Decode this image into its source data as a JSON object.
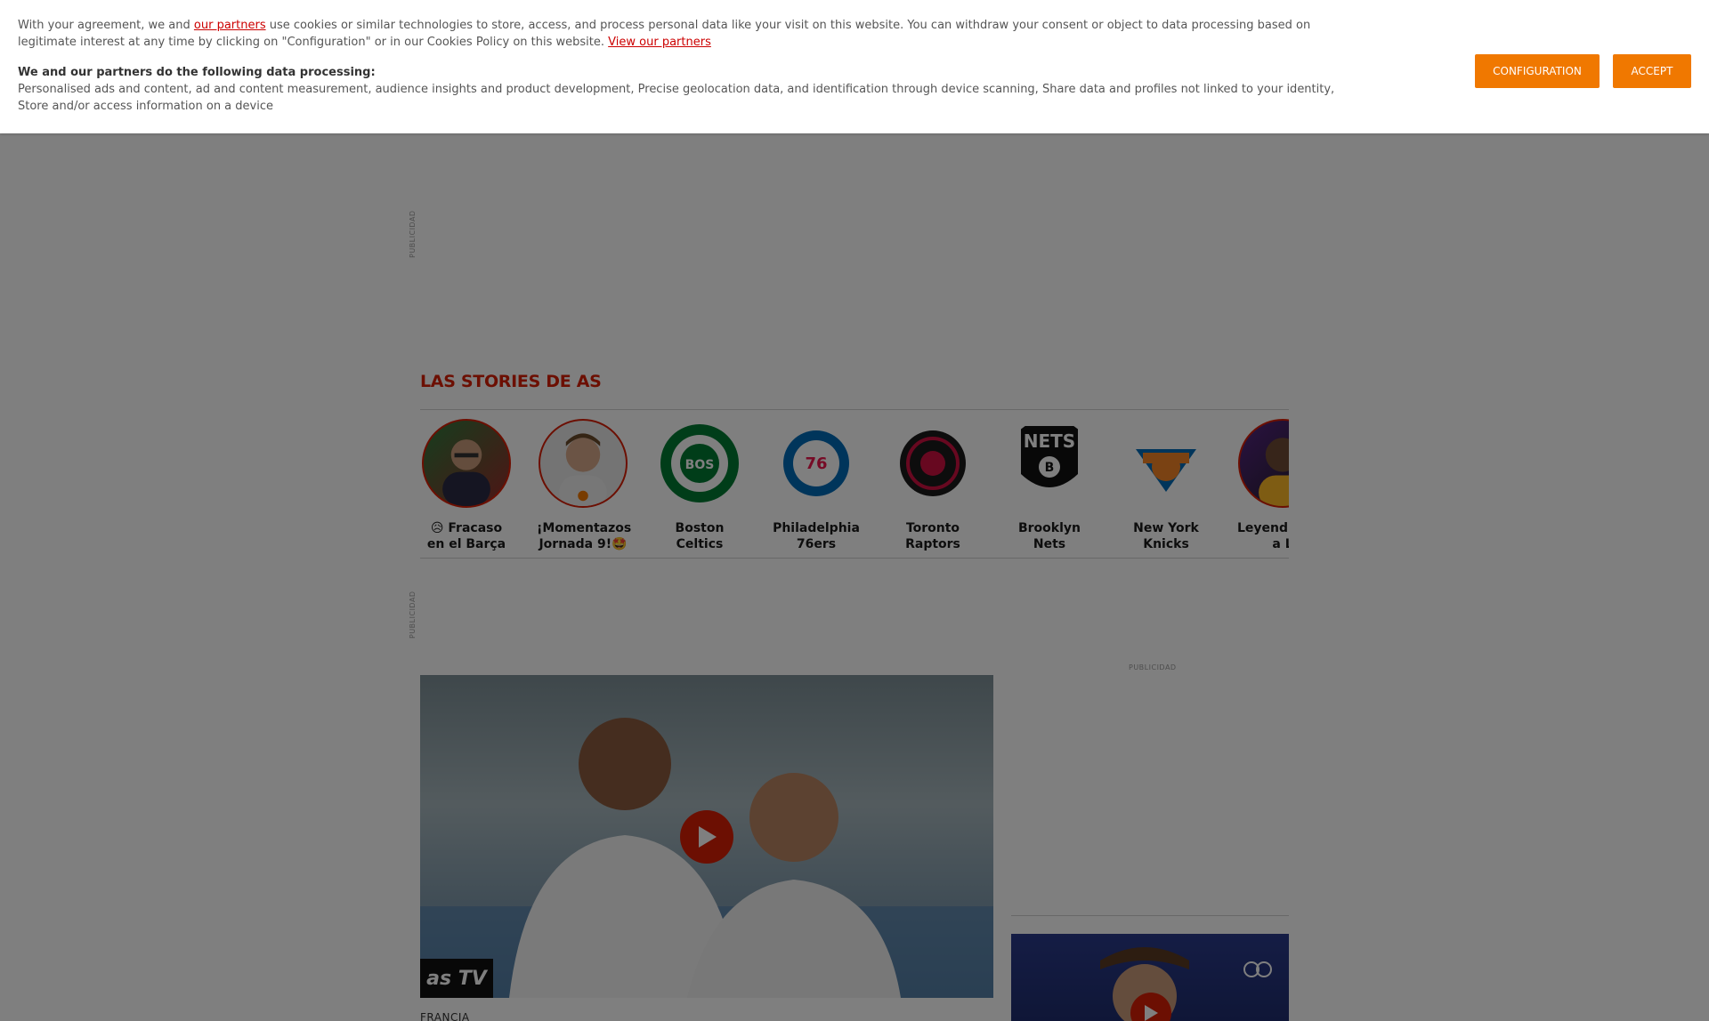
{
  "cookie_banner": {
    "text_part1": "With your agreement, we and ",
    "partners_link": "our partners",
    "text_part2": " use cookies or similar technologies to store, access, and process personal data like your visit on this website. You can withdraw your consent or object to data processing based on legitimate interest at any time by clicking on \"Configuration\" or in our Cookies Policy on this website. ",
    "view_partners_link": "View our partners",
    "processing_heading": "We and our partners do the following data processing:",
    "processing_text": "Personalised ads and content, ad and content measurement, audience insights and product development, Precise geolocation data, and identification through device scanning, Share data and profiles not linked to your identity, Store and/or access information on a device",
    "configuration_button": "CONFIGURATION",
    "accept_button": "ACCEPT",
    "button_color": "#f07800",
    "link_color": "#cc0000"
  },
  "ads": {
    "label": "PUBLICIDAD"
  },
  "stories": {
    "title": "LAS STORIES DE AS",
    "title_color": "#d81e05",
    "items": [
      {
        "label": "😥 Fracaso en el Barça",
        "icon": "person-photo"
      },
      {
        "label": "¡Momentazos Jornada 9!🤩",
        "icon": "person-photo"
      },
      {
        "label": "Boston Celtics",
        "icon": "boston-celtics-logo"
      },
      {
        "label": "Philadelphia 76ers",
        "icon": "philadelphia-76ers-logo"
      },
      {
        "label": "Toronto Raptors",
        "icon": "toronto-raptors-logo"
      },
      {
        "label": "Brooklyn Nets",
        "icon": "brooklyn-nets-logo"
      },
      {
        "label": "New York Knicks",
        "icon": "new-york-knicks-logo"
      },
      {
        "label": "Leyend mate a L",
        "icon": "person-photo"
      }
    ]
  },
  "main_video": {
    "badge": "as TV",
    "section": "FRANCIA"
  }
}
